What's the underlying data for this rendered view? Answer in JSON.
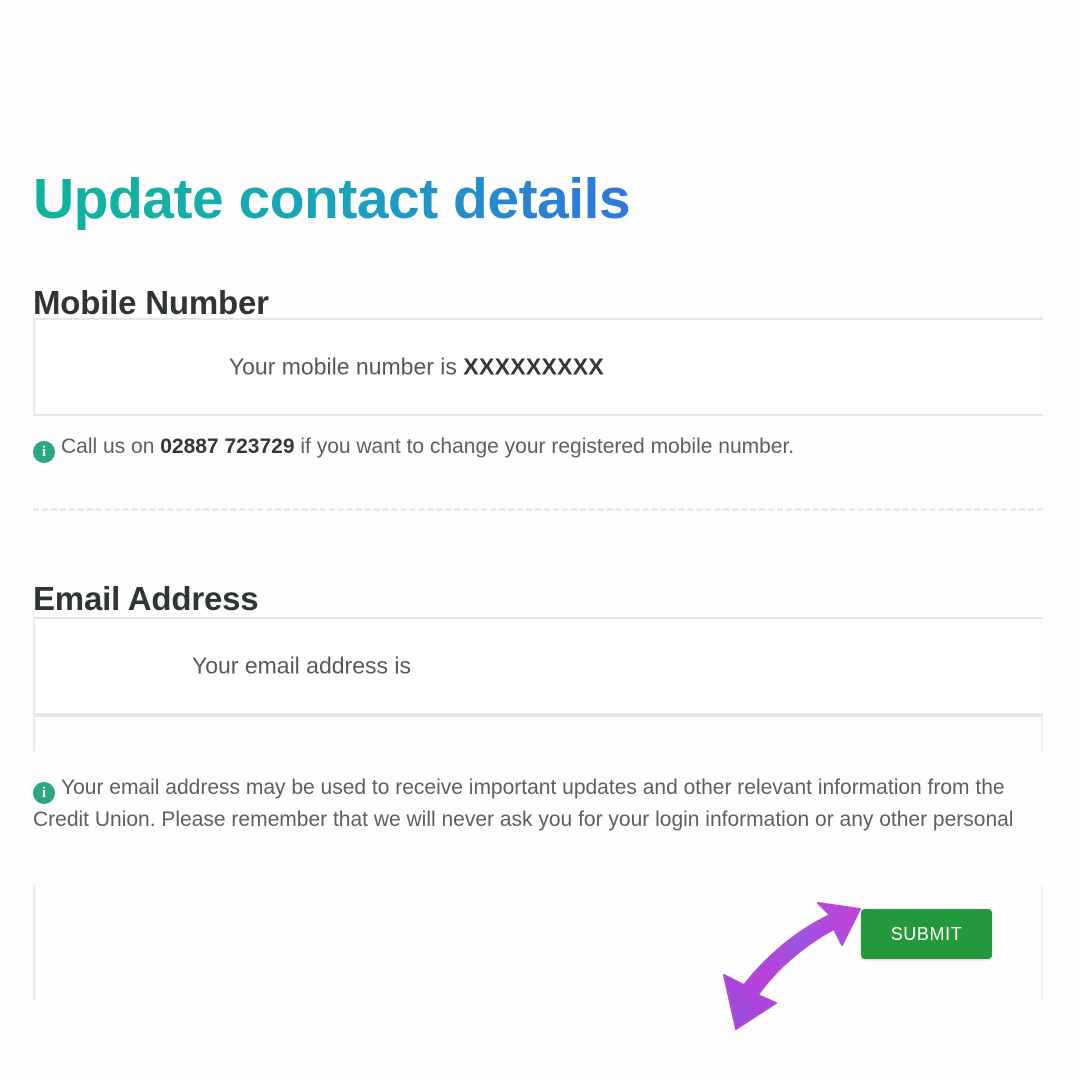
{
  "page": {
    "title": "Update contact details"
  },
  "mobile_section": {
    "heading": "Mobile Number",
    "field_label": "Your mobile number is ",
    "field_value_masked": "XXXXXXXXX",
    "note_prefix": "Call us on ",
    "note_phone": "02887 723729",
    "note_suffix": " if you want to change your registered mobile number.",
    "info_icon": "info-icon",
    "info_icon_glyph": "i"
  },
  "email_section": {
    "heading": "Email Address",
    "field_label": "Your email address is",
    "field_value": "",
    "note_text": "Your email address may be used to receive important updates and other relevant information from the Credit Union. Please remember that we will never ask you for your login information or any other personal",
    "info_icon": "info-icon",
    "info_icon_glyph": "i"
  },
  "footer": {
    "submit_label": "SUBMIT",
    "annotation": "purple-arrow-pointing-to-submit"
  },
  "colors": {
    "title_gradient_start": "#0fb39a",
    "title_gradient_end": "#2f79da",
    "submit_green": "#24993c",
    "info_icon_green": "#2aa87f",
    "arrow_purple": "#a24ee0",
    "arrow_magenta": "#d836d8",
    "heading_text": "#2f3436",
    "body_text": "#5b6064",
    "field_border": "#e4e6e8"
  }
}
